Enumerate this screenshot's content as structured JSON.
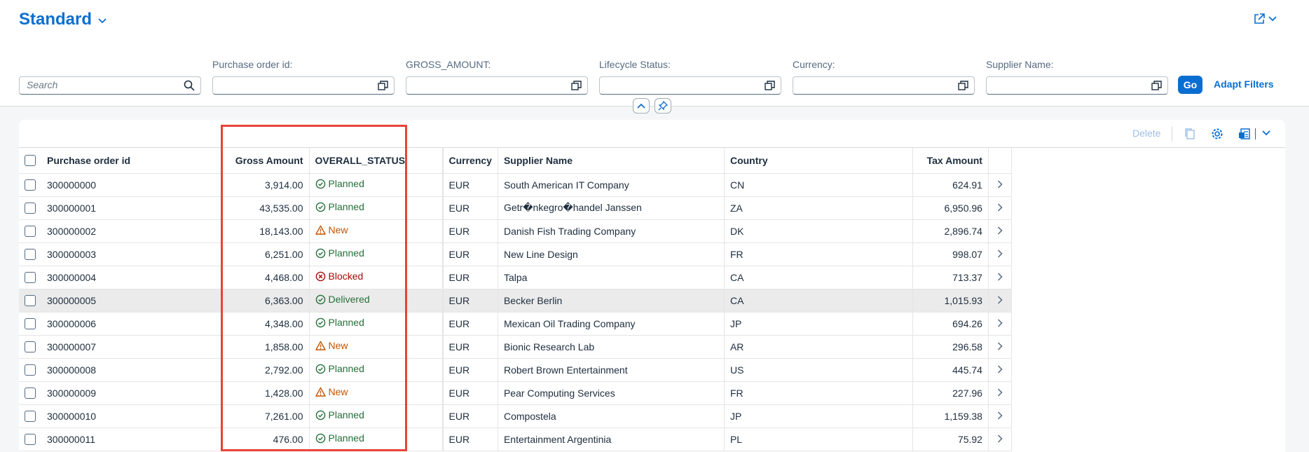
{
  "variant": {
    "title": "Standard"
  },
  "search": {
    "placeholder": "Search"
  },
  "filters": [
    {
      "label": "Purchase order id:",
      "value": ""
    },
    {
      "label": "GROSS_AMOUNT:",
      "value": ""
    },
    {
      "label": "Lifecycle Status:",
      "value": ""
    },
    {
      "label": "Currency:",
      "value": ""
    },
    {
      "label": "Supplier Name:",
      "value": ""
    }
  ],
  "buttons": {
    "go": "Go",
    "adapt_filters": "Adapt Filters",
    "delete": "Delete"
  },
  "table": {
    "columns": [
      "Purchase order id",
      "Gross Amount",
      "OVERALL_STATUS",
      "",
      "Currency",
      "Supplier Name",
      "Country",
      "Tax Amount"
    ],
    "rows": [
      {
        "id": "300000000",
        "gross": "3,914.00",
        "status": "Planned",
        "currency": "EUR",
        "supplier": "South American IT Company",
        "country": "CN",
        "tax": "624.91"
      },
      {
        "id": "300000001",
        "gross": "43,535.00",
        "status": "Planned",
        "currency": "EUR",
        "supplier": "Getr�nkegro�handel Janssen",
        "country": "ZA",
        "tax": "6,950.96"
      },
      {
        "id": "300000002",
        "gross": "18,143.00",
        "status": "New",
        "currency": "EUR",
        "supplier": "Danish Fish Trading Company",
        "country": "DK",
        "tax": "2,896.74"
      },
      {
        "id": "300000003",
        "gross": "6,251.00",
        "status": "Planned",
        "currency": "EUR",
        "supplier": "New Line Design",
        "country": "FR",
        "tax": "998.07"
      },
      {
        "id": "300000004",
        "gross": "4,468.00",
        "status": "Blocked",
        "currency": "EUR",
        "supplier": "Talpa",
        "country": "CA",
        "tax": "713.37"
      },
      {
        "id": "300000005",
        "gross": "6,363.00",
        "status": "Delivered",
        "currency": "EUR",
        "supplier": "Becker Berlin",
        "country": "CA",
        "tax": "1,015.93"
      },
      {
        "id": "300000006",
        "gross": "4,348.00",
        "status": "Planned",
        "currency": "EUR",
        "supplier": "Mexican Oil Trading Company",
        "country": "JP",
        "tax": "694.26"
      },
      {
        "id": "300000007",
        "gross": "1,858.00",
        "status": "New",
        "currency": "EUR",
        "supplier": "Bionic Research Lab",
        "country": "AR",
        "tax": "296.58"
      },
      {
        "id": "300000008",
        "gross": "2,792.00",
        "status": "Planned",
        "currency": "EUR",
        "supplier": "Robert Brown Entertainment",
        "country": "US",
        "tax": "445.74"
      },
      {
        "id": "300000009",
        "gross": "1,428.00",
        "status": "New",
        "currency": "EUR",
        "supplier": "Pear Computing Services",
        "country": "FR",
        "tax": "227.96"
      },
      {
        "id": "300000010",
        "gross": "7,261.00",
        "status": "Planned",
        "currency": "EUR",
        "supplier": "Compostela",
        "country": "JP",
        "tax": "1,159.38"
      },
      {
        "id": "300000011",
        "gross": "476.00",
        "status": "Planned",
        "currency": "EUR",
        "supplier": "Entertainment Argentinia",
        "country": "PL",
        "tax": "75.92"
      }
    ]
  },
  "colors": {
    "accent": "#0a6ed1",
    "positive": "#256f3a",
    "critical": "#c35500",
    "negative": "#aa0808",
    "highlight_box": "#e8433a"
  }
}
